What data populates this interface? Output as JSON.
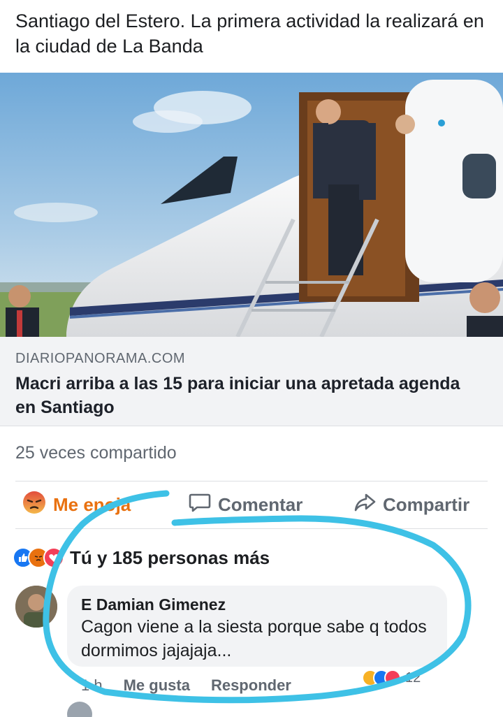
{
  "post": {
    "text": "Santiago del Estero. La primera actividad la realizará en la ciudad de La Banda"
  },
  "link": {
    "domain": "DIARIOPANORAMA.COM",
    "title": "Macri arriba a las 15 para iniciar una apretada agenda en Santiago"
  },
  "shares": {
    "text": "25 veces compartido"
  },
  "actions": {
    "react_label": "Me enoja",
    "comment_label": "Comentar",
    "share_label": "Compartir"
  },
  "reactions": {
    "summary": "Tú y 185 personas más"
  },
  "comment": {
    "author": "E Damian Gimenez",
    "text": "Cagon viene a la siesta porque sabe q todos dormimos jajajaja...",
    "time": "1 h",
    "like_label": "Me gusta",
    "reply_label": "Responder",
    "reaction_count": "12"
  },
  "colors": {
    "angry": "#e9710f",
    "like_blue": "#1877f2",
    "love_red": "#f33e58",
    "highlight": "#3ec1e6"
  }
}
